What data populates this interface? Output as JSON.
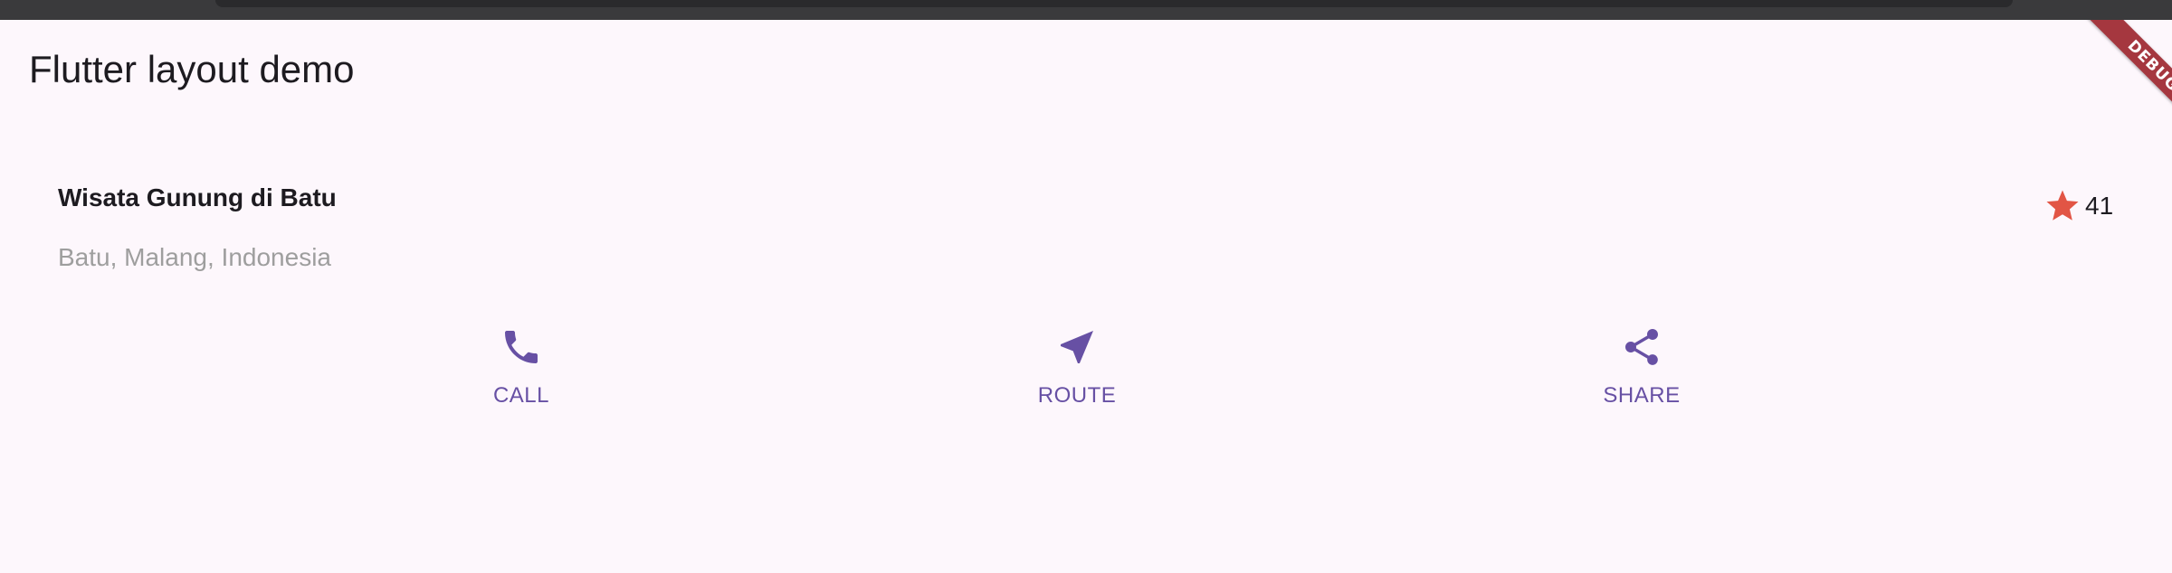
{
  "app_bar": {
    "title": "Flutter layout demo",
    "debug_banner": "DEBUG"
  },
  "title_section": {
    "name": "Wisata Gunung di Batu",
    "location": "Batu, Malang, Indonesia",
    "rating": {
      "icon": "star-icon",
      "count": "41",
      "color": "#e25545"
    }
  },
  "button_section": {
    "accent_color": "#6750a4",
    "buttons": [
      {
        "icon": "phone-icon",
        "label": "CALL"
      },
      {
        "icon": "navigation-arrow-icon",
        "label": "ROUTE"
      },
      {
        "icon": "share-icon",
        "label": "SHARE"
      }
    ]
  },
  "colors": {
    "background": "#fdf7fc",
    "title_text": "#1d1b20",
    "secondary_text": "#9e9e9e",
    "debug_banner": "#a5373f"
  }
}
